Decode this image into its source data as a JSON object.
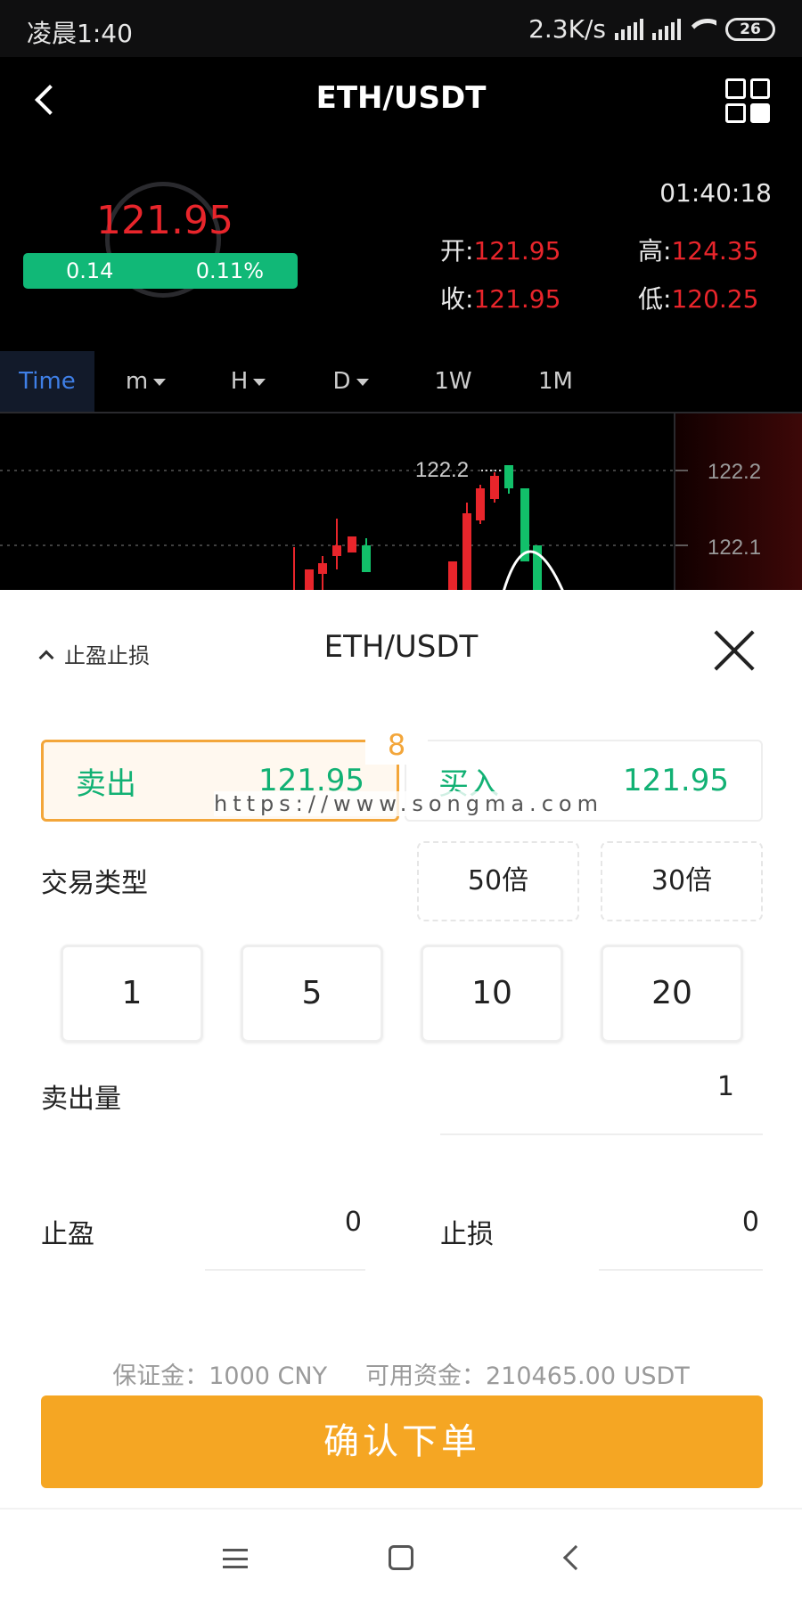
{
  "status_bar": {
    "time": "凌晨1:40",
    "speed": "2.3K/s",
    "battery": "26"
  },
  "header": {
    "title": "ETH/USDT"
  },
  "ticker": {
    "price": "121.95",
    "change": "0.14",
    "change_pct": "0.11%",
    "clock": "01:40:18",
    "open_label": "开:",
    "open": "121.95",
    "high_label": "高:",
    "high": "124.35",
    "close_label": "收:",
    "close": "121.95",
    "low_label": "低:",
    "low": "120.25"
  },
  "tabs": [
    {
      "label": "Time",
      "dropdown": false
    },
    {
      "label": "m",
      "dropdown": true
    },
    {
      "label": "H",
      "dropdown": true
    },
    {
      "label": "D",
      "dropdown": true
    },
    {
      "label": "1W",
      "dropdown": false
    },
    {
      "label": "1M",
      "dropdown": false
    }
  ],
  "chart": {
    "peak_label": "122.2",
    "axis_labels": [
      "122.2",
      "122.1"
    ],
    "colors": {
      "up": "#e8252b",
      "down": "#12c06a"
    }
  },
  "sheet": {
    "toggle_label": "止盈止损",
    "title": "ETH/USDT",
    "sell_label": "卖出",
    "sell_price": "121.95",
    "buy_label": "买入",
    "buy_price": "121.95",
    "badge": "8",
    "watermark": "https://www.songma.com",
    "trade_type_label": "交易类型",
    "leverage": [
      "50倍",
      "30倍"
    ],
    "quantities": [
      "1",
      "5",
      "10",
      "20"
    ],
    "sell_qty_label": "卖出量",
    "sell_qty": "1",
    "tp_label": "止盈",
    "tp_value": "0",
    "sl_label": "止损",
    "sl_value": "0",
    "margin_info": "保证金：1000 CNY",
    "available_info": "可用资金：210465.00 USDT",
    "confirm_label": "确认下单"
  },
  "colors": {
    "accent": "#f5a623",
    "green": "#12b174",
    "red": "#e8252b"
  }
}
